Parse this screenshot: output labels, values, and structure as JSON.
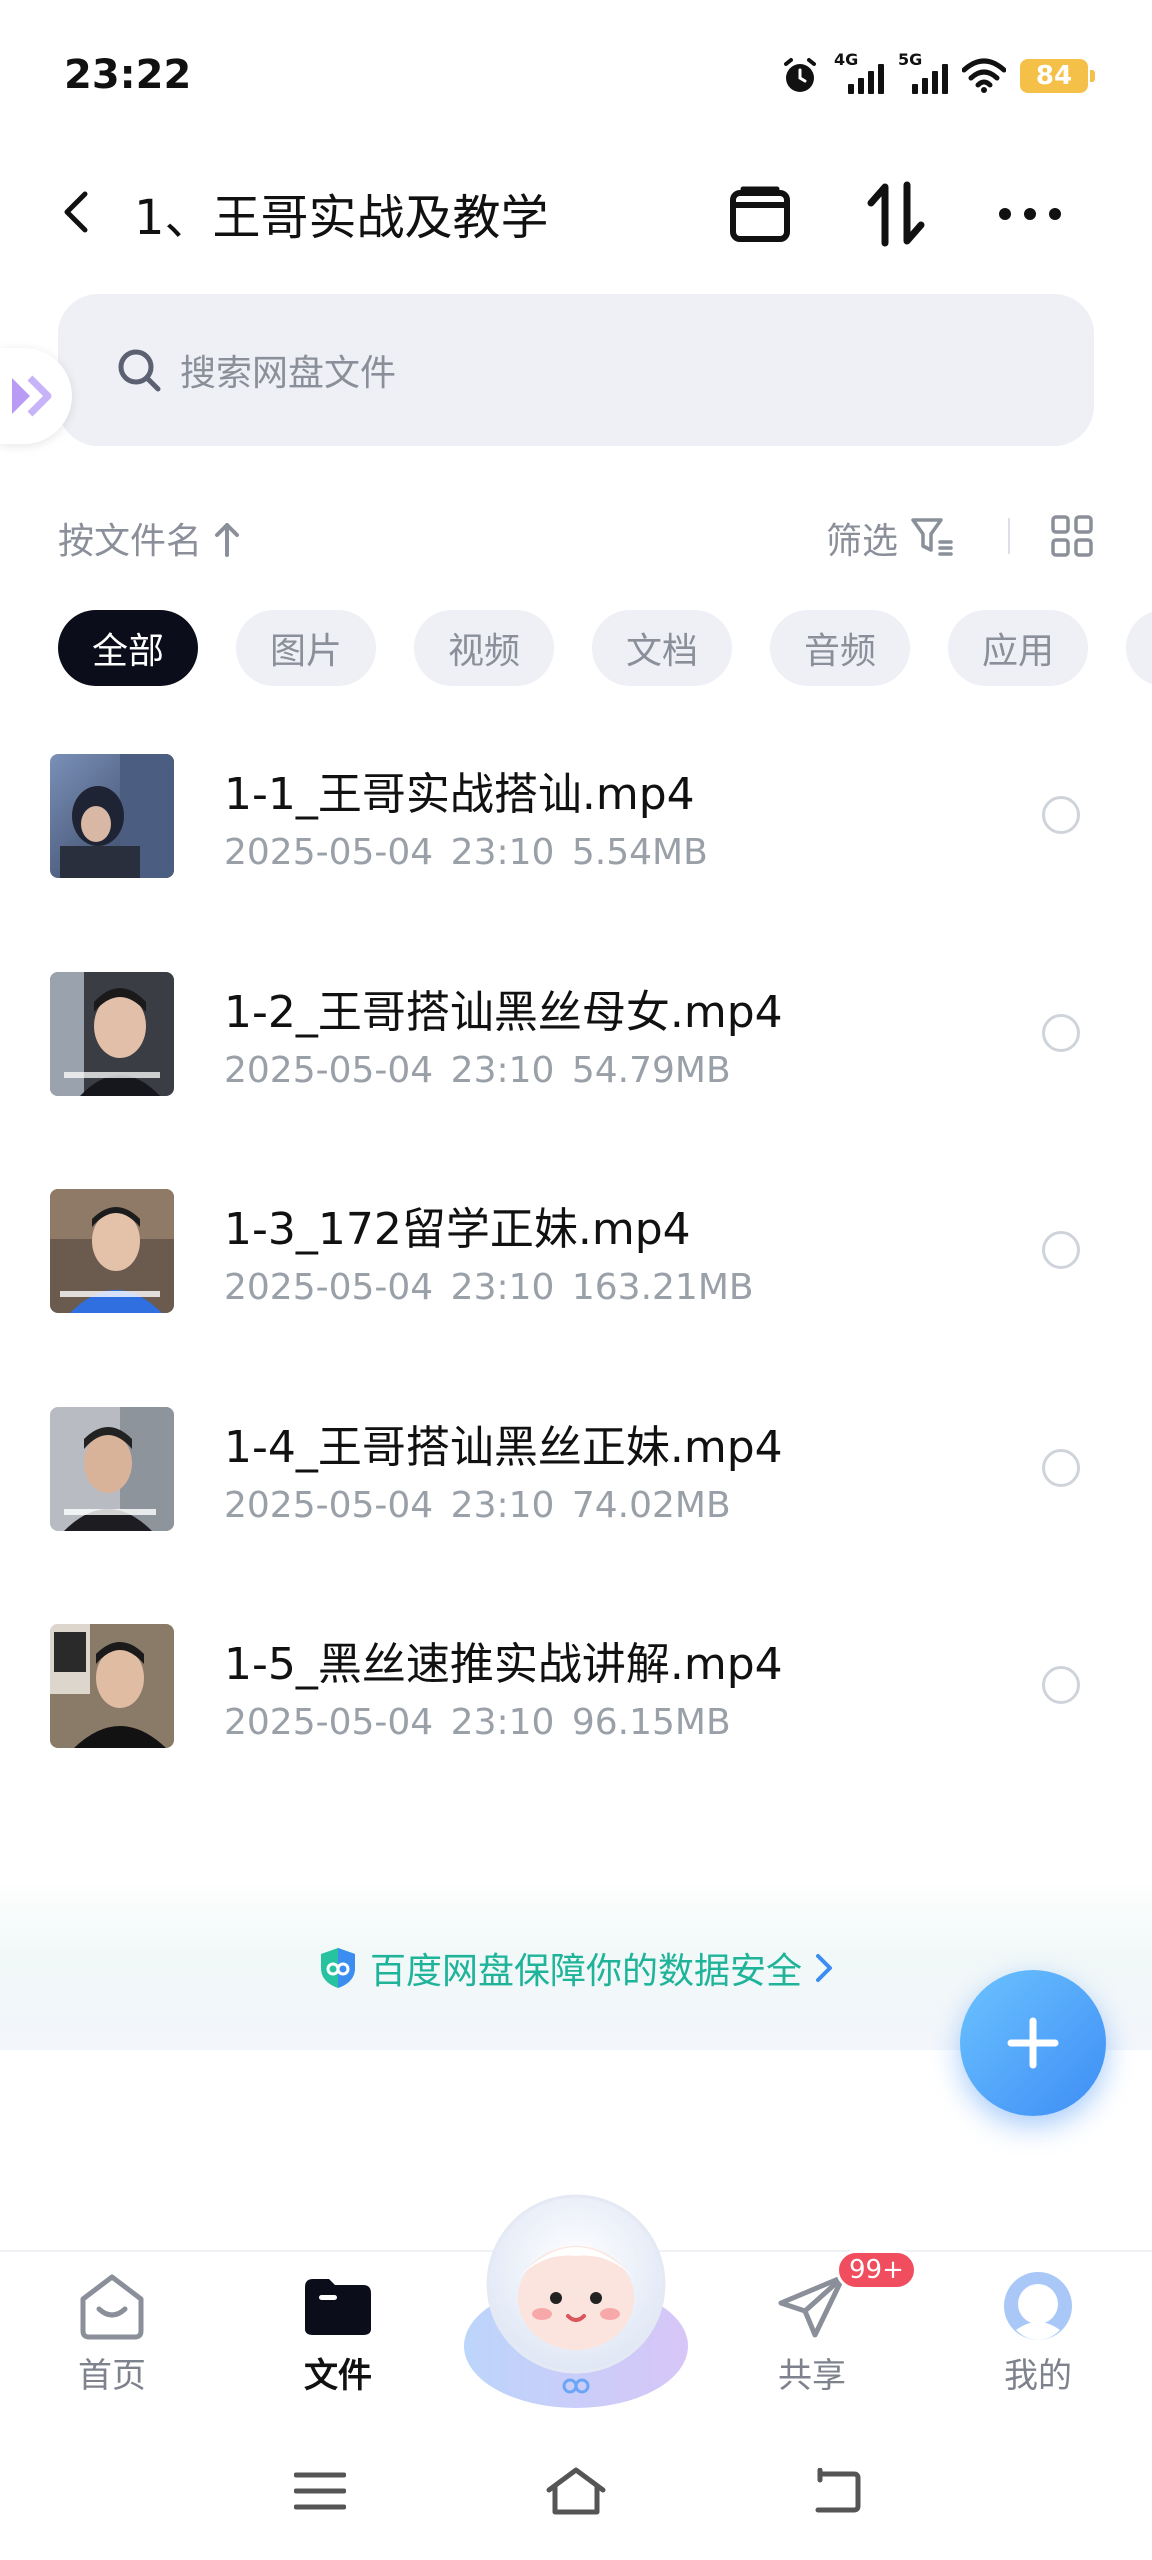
{
  "status_bar": {
    "time": "23:22",
    "net1": "4G",
    "net2": "5G",
    "battery": "84"
  },
  "header": {
    "title": "1、王哥实战及教学",
    "icons": [
      "back-arrow-icon",
      "window-icon",
      "sort-icon",
      "more-icon"
    ]
  },
  "search": {
    "placeholder": "搜索网盘文件"
  },
  "sort": {
    "label": "按文件名",
    "filter_label": "筛选"
  },
  "categories": [
    "全部",
    "图片",
    "视频",
    "文档",
    "音频",
    "应用"
  ],
  "selected_category": "全部",
  "files": [
    {
      "name": "1-1_王哥实战搭讪.mp4",
      "date": "2025-05-04",
      "time": "23:10",
      "size": "5.54MB"
    },
    {
      "name": "1-2_王哥搭讪黑丝母女.mp4",
      "date": "2025-05-04",
      "time": "23:10",
      "size": "54.79MB"
    },
    {
      "name": "1-3_172留学正妹.mp4",
      "date": "2025-05-04",
      "time": "23:10",
      "size": "163.21MB"
    },
    {
      "name": "1-4_王哥搭讪黑丝正妹.mp4",
      "date": "2025-05-04",
      "time": "23:10",
      "size": "74.02MB"
    },
    {
      "name": "1-5_黑丝速推实战讲解.mp4",
      "date": "2025-05-04",
      "time": "23:10",
      "size": "96.15MB"
    }
  ],
  "security_banner": {
    "text": "百度网盘保障你的数据安全"
  },
  "bottom_nav": {
    "home": "首页",
    "files": "文件",
    "share": "共享",
    "share_badge": "99+",
    "mine": "我的",
    "active": "文件"
  },
  "colors": {
    "accent": "#3d8df5",
    "security_green": "#1fb39a",
    "badge_red": "#f04d5f",
    "chip_active": "#0b0d1a",
    "battery": "#f5c048"
  }
}
